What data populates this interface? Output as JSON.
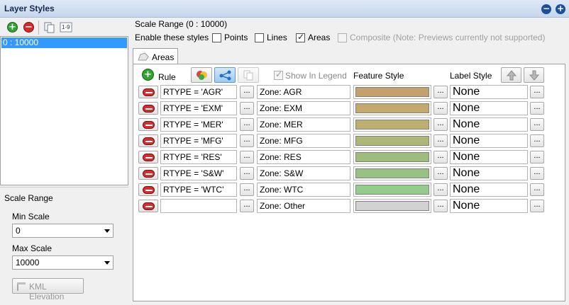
{
  "window": {
    "title": "Layer Styles"
  },
  "titlebar_buttons": {
    "minimize_glyph": "−",
    "add_glyph": "+"
  },
  "left_toolbar": {
    "add_icon": "+",
    "remove_icon": "−",
    "duplicate_icon": "copy-icon",
    "sort_icon": "1-9"
  },
  "layer_list": {
    "items": [
      {
        "label": "0 : 10000",
        "selected": true
      }
    ]
  },
  "scale_panel": {
    "title": "Scale Range",
    "min_label": "Min Scale",
    "min_value": "0",
    "max_label": "Max Scale",
    "max_value": "10000",
    "kml_button": "KML Elevation"
  },
  "right": {
    "heading": "Scale Range (0 : 10000)",
    "enable_label": "Enable these styles",
    "checkboxes": [
      {
        "label": "Points",
        "checked": false,
        "disabled": false
      },
      {
        "label": "Lines",
        "checked": false,
        "disabled": false
      },
      {
        "label": "Areas",
        "checked": true,
        "disabled": false
      },
      {
        "label": "Composite (Note: Previews currently not supported)",
        "checked": false,
        "disabled": true
      }
    ],
    "tab_label": "Areas",
    "columns": {
      "rule": "Rule",
      "show_in_legend": "Show In Legend",
      "feature_style": "Feature Style",
      "label_style": "Label Style"
    },
    "ellipsis": "...",
    "rules": [
      {
        "filter": "RTYPE = 'AGR'",
        "legend": "Zone:  AGR",
        "color": "#c4a06c",
        "label": "None"
      },
      {
        "filter": "RTYPE = 'EXM'",
        "legend": "Zone:  EXM",
        "color": "#c4a86c",
        "label": "None"
      },
      {
        "filter": "RTYPE = 'MER'",
        "legend": "Zone:  MER",
        "color": "#bcb070",
        "label": "None"
      },
      {
        "filter": "RTYPE = 'MFG'",
        "legend": "Zone:  MFG",
        "color": "#aeb678",
        "label": "None"
      },
      {
        "filter": "RTYPE = 'RES'",
        "legend": "Zone:  RES",
        "color": "#a0bc7c",
        "label": "None"
      },
      {
        "filter": "RTYPE = 'S&W'",
        "legend": "Zone:  S&W",
        "color": "#98c284",
        "label": "None"
      },
      {
        "filter": "RTYPE = 'WTC'",
        "legend": "Zone:  WTC",
        "color": "#94cc8c",
        "label": "None"
      },
      {
        "filter": "",
        "legend": "Zone:  Other",
        "color": "#d2d2d2",
        "label": "None"
      }
    ]
  }
}
